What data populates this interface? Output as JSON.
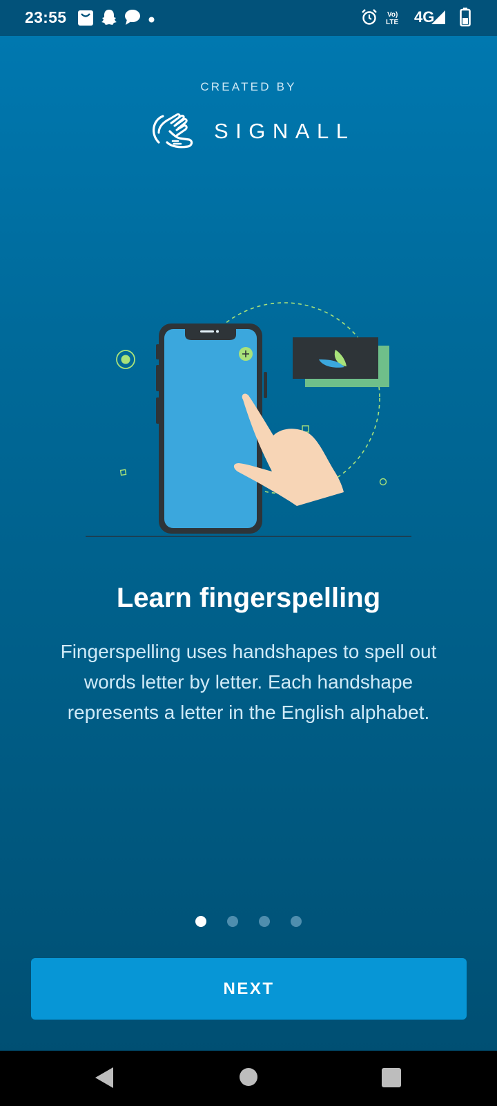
{
  "status_bar": {
    "time": "23:55",
    "left_icons": [
      "shopping-bag-icon",
      "snapchat-icon",
      "chat-bubble-icon",
      "notification-dot-icon"
    ],
    "right_icons": [
      "alarm-icon",
      "volte-icon",
      "signal-icon",
      "battery-icon"
    ],
    "volte_text": "Vo) LTE",
    "network_label": "4G"
  },
  "header": {
    "created_by": "CREATED BY",
    "brand_name": "SIGNALL",
    "logo_icon": "signall-hands-logo-icon"
  },
  "illustration": {
    "icon": "phone-with-hand-illustration"
  },
  "slide": {
    "title": "Learn fingerspelling",
    "description": "Fingerspelling uses handshapes to spell out words letter by letter. Each handshape represents a letter in the English alphabet."
  },
  "pagination": {
    "total": 4,
    "active_index": 0
  },
  "actions": {
    "next_label": "NEXT"
  },
  "nav_bar": {
    "buttons": [
      "back-icon",
      "home-icon",
      "recents-icon"
    ]
  },
  "colors": {
    "background_top": "#0078b0",
    "background_bottom": "#004d70",
    "status_bar": "#02527a",
    "button": "#0796d6",
    "accent_green": "#a8e27a",
    "phone_screen": "#3ba7dd",
    "hand": "#f7d5b6"
  }
}
